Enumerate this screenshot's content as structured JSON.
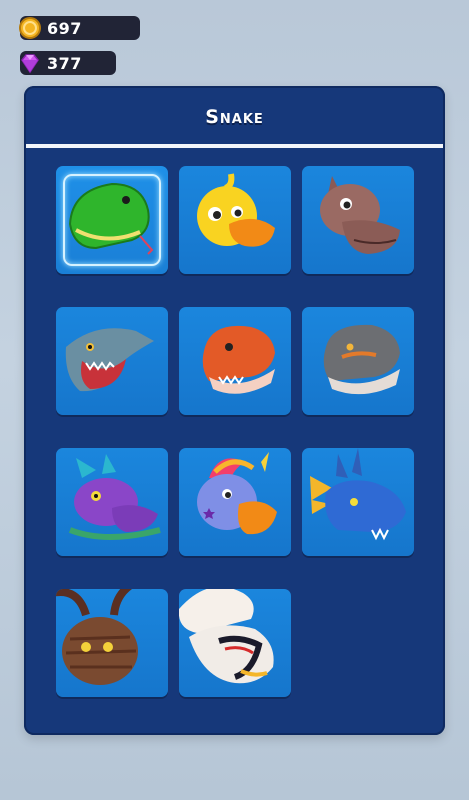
{
  "currency": {
    "coins": {
      "value": "697",
      "icon": "coin-icon",
      "color": "#f2b21c"
    },
    "gems": {
      "value": "377",
      "icon": "gem-icon",
      "color": "#c24de8"
    }
  },
  "panel": {
    "title": "Snake",
    "selected_index": 0,
    "characters": [
      {
        "icon": "snake-head-icon"
      },
      {
        "icon": "duck-head-icon"
      },
      {
        "icon": "hippo-head-icon"
      },
      {
        "icon": "shark-head-icon"
      },
      {
        "icon": "orange-dinosaur-head-icon"
      },
      {
        "icon": "gray-dinosaur-head-icon"
      },
      {
        "icon": "purple-dragon-head-icon"
      },
      {
        "icon": "unicorn-head-icon"
      },
      {
        "icon": "blue-dragon-head-icon"
      },
      {
        "icon": "horned-beast-head-icon"
      },
      {
        "icon": "white-dragon-head-icon"
      }
    ]
  },
  "colors": {
    "panel": "#16387a",
    "card": "#1a7fd6",
    "accent": "#ffffff"
  }
}
